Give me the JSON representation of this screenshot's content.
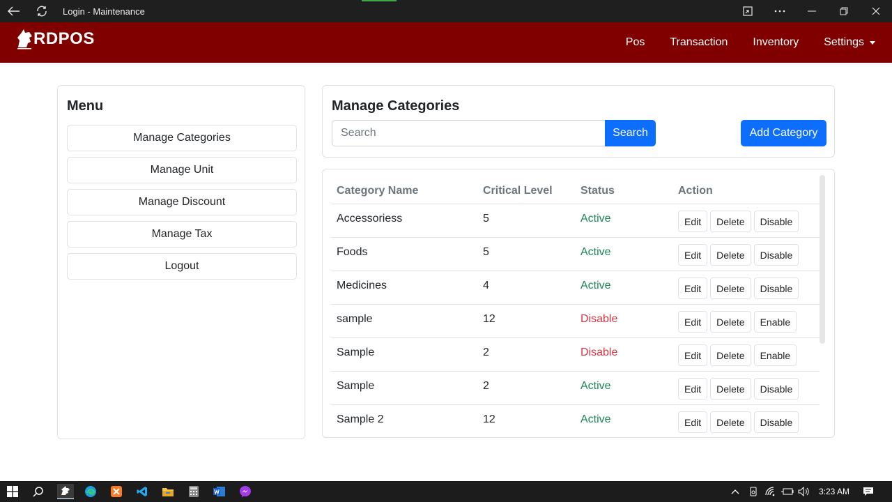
{
  "window": {
    "title": "Login - Maintenance",
    "icons": [
      "back-arrow-icon",
      "refresh-icon",
      "screen-cast-icon",
      "more-icon",
      "minimize-icon",
      "restore-icon",
      "close-icon"
    ]
  },
  "navbar": {
    "brand": "RDPOS",
    "links": [
      "Pos",
      "Transaction",
      "Inventory",
      "Settings"
    ],
    "bg_color": "#800000"
  },
  "menu": {
    "title": "Menu",
    "items": [
      "Manage Categories",
      "Manage Unit",
      "Manage Discount",
      "Manage Tax",
      "Logout"
    ]
  },
  "main": {
    "title": "Manage Categories",
    "search_placeholder": "Search",
    "search_button": "Search",
    "add_button": "Add Category",
    "accent_color": "#0d6efd"
  },
  "table": {
    "columns": [
      "Category Name",
      "Critical Level",
      "Status",
      "Action"
    ],
    "rows": [
      {
        "name": "Accessoriess",
        "level": "5",
        "status": "Active",
        "actions": [
          "Edit",
          "Delete",
          "Disable"
        ]
      },
      {
        "name": "Foods",
        "level": "5",
        "status": "Active",
        "actions": [
          "Edit",
          "Delete",
          "Disable"
        ]
      },
      {
        "name": "Medicines",
        "level": "4",
        "status": "Active",
        "actions": [
          "Edit",
          "Delete",
          "Disable"
        ]
      },
      {
        "name": "sample",
        "level": "12",
        "status": "Disable",
        "actions": [
          "Edit",
          "Delete",
          "Enable"
        ]
      },
      {
        "name": "Sample",
        "level": "2",
        "status": "Disable",
        "actions": [
          "Edit",
          "Delete",
          "Enable"
        ]
      },
      {
        "name": "Sample",
        "level": "2",
        "status": "Active",
        "actions": [
          "Edit",
          "Delete",
          "Disable"
        ]
      },
      {
        "name": "Sample 2",
        "level": "12",
        "status": "Active",
        "actions": [
          "Edit",
          "Delete",
          "Disable"
        ]
      }
    ],
    "status_colors": {
      "Active": "#198754",
      "Disable": "#dc3545"
    }
  },
  "taskbar": {
    "time": "3:23 AM",
    "apps": [
      "windows-start-icon",
      "search-icon",
      "rdpos-app-icon",
      "edge-icon",
      "xampp-icon",
      "vscode-icon",
      "file-explorer-icon",
      "calculator-icon",
      "word-icon",
      "messenger-icon"
    ]
  }
}
